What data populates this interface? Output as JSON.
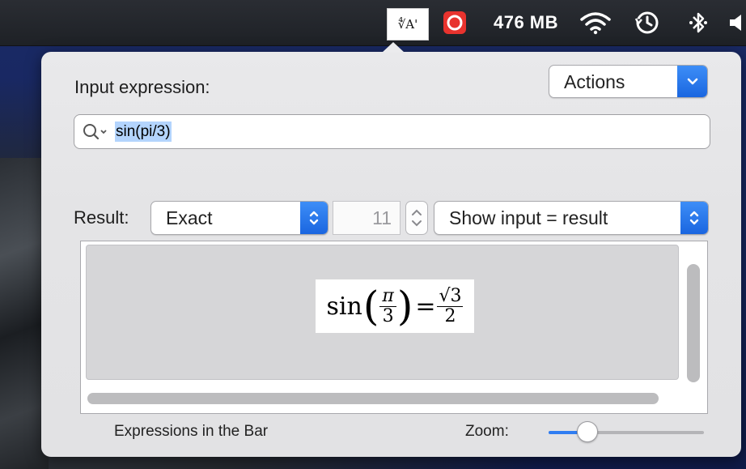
{
  "menubar": {
    "math_icon_text": "∜A'",
    "memory": "476 MB",
    "icons": [
      "math-expression-icon",
      "record-icon",
      "wifi-icon",
      "time-machine-icon",
      "bluetooth-icon",
      "speaker-icon"
    ]
  },
  "popover": {
    "input_label": "Input expression:",
    "actions_label": "Actions",
    "search_value": "sin(pi/3)",
    "result_label": "Result:",
    "result_mode": "Exact",
    "precision": "11",
    "display_mode": "Show input = result",
    "formula": {
      "fn": "sin",
      "arg_num": "π",
      "arg_den": "3",
      "eq": "=",
      "res_num": "√3",
      "res_den": "2"
    },
    "footer_left": "Expressions in the Bar",
    "zoom_label": "Zoom:",
    "zoom_level": 0.25
  },
  "colors": {
    "accent": "#1a66e0",
    "selection": "#b3d4fd"
  }
}
